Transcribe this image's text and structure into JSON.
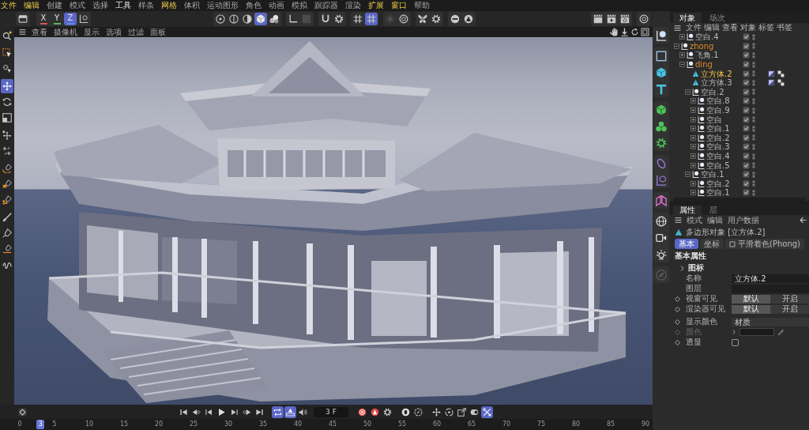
{
  "menu_bar": [
    {
      "label": "文件",
      "highlighted": true,
      "hovered": false
    },
    {
      "label": "编辑",
      "highlighted": true,
      "hovered": false
    },
    {
      "label": "创建",
      "highlighted": false,
      "hovered": false
    },
    {
      "label": "模式",
      "highlighted": false,
      "hovered": false
    },
    {
      "label": "选择",
      "highlighted": false,
      "hovered": false
    },
    {
      "label": "工具",
      "highlighted": false,
      "hovered": true
    },
    {
      "label": "样条",
      "highlighted": false,
      "hovered": false
    },
    {
      "label": "网格",
      "highlighted": true,
      "hovered": false
    },
    {
      "label": "体积",
      "highlighted": false,
      "hovered": false
    },
    {
      "label": "运动图形",
      "highlighted": false,
      "hovered": false
    },
    {
      "label": "角色",
      "highlighted": false,
      "hovered": false
    },
    {
      "label": "动画",
      "highlighted": false,
      "hovered": false
    },
    {
      "label": "模拟",
      "highlighted": false,
      "hovered": false
    },
    {
      "label": "跟踪器",
      "highlighted": false,
      "hovered": false
    },
    {
      "label": "渲染",
      "highlighted": false,
      "hovered": false
    },
    {
      "label": "扩展",
      "highlighted": true,
      "hovered": false
    },
    {
      "label": "窗口",
      "highlighted": true,
      "hovered": false
    },
    {
      "label": "帮助",
      "highlighted": false,
      "hovered": false
    }
  ],
  "toolbar": {
    "left": [
      [
        {
          "kind": "panel",
          "selected": false
        }
      ],
      [
        {
          "kind": "axis",
          "label": "X",
          "color": "#d9534f",
          "selected": false
        },
        {
          "kind": "axis",
          "label": "Y",
          "color": "#5cb85c",
          "selected": false
        },
        {
          "kind": "axis",
          "label": "Z",
          "color": "#5b8ee6",
          "selected": true
        },
        {
          "kind": "coord",
          "selected": false
        }
      ]
    ],
    "center": [
      [
        {
          "kind": "dotcircle",
          "selected": false
        },
        {
          "kind": "splitcircle",
          "selected": false
        },
        {
          "kind": "halfcircle",
          "selected": false
        },
        {
          "kind": "cube",
          "selected": true
        },
        {
          "kind": "cubes",
          "selected": false
        }
      ],
      [
        {
          "kind": "corner",
          "selected": false
        },
        {
          "kind": "blank",
          "selected": false
        }
      ],
      [
        {
          "kind": "magnet",
          "selected": false
        },
        {
          "kind": "gear",
          "selected": false
        }
      ],
      [
        {
          "kind": "hash",
          "selected": false
        },
        {
          "kind": "hash",
          "selected": true
        }
      ],
      [
        {
          "kind": "playcircle",
          "selected": false
        },
        {
          "kind": "ring",
          "selected": false
        }
      ],
      [
        {
          "kind": "butterfly",
          "selected": false
        },
        {
          "kind": "gear",
          "selected": false
        }
      ],
      [
        {
          "kind": "minuscircle",
          "selected": false
        },
        {
          "kind": "trianglecircle",
          "selected": false
        }
      ]
    ],
    "right": [
      [
        {
          "kind": "clapper",
          "selected": false
        },
        {
          "kind": "clapperplay",
          "selected": false
        },
        {
          "kind": "clappergear",
          "selected": false
        }
      ],
      [
        {
          "kind": "ring",
          "selected": false
        }
      ]
    ]
  },
  "tools": [
    [
      {
        "kind": "search",
        "selected": false
      }
    ],
    [
      {
        "kind": "selectrect",
        "selected": false
      },
      {
        "kind": "pointergear",
        "selected": false
      }
    ],
    [
      {
        "kind": "move",
        "selected": true
      },
      {
        "kind": "rotate",
        "selected": false
      },
      {
        "kind": "scale",
        "selected": false
      }
    ],
    [
      {
        "kind": "moveplus",
        "selected": false
      },
      {
        "kind": "scatter",
        "selected": false
      }
    ],
    [
      {
        "kind": "penarc",
        "selected": false
      },
      {
        "kind": "penrect",
        "selected": false
      },
      {
        "kind": "pendots",
        "selected": false
      }
    ],
    [
      {
        "kind": "brush",
        "selected": false
      },
      {
        "kind": "pen",
        "selected": false
      },
      {
        "kind": "penline",
        "selected": false
      },
      {
        "kind": "squiggle",
        "selected": false
      }
    ]
  ],
  "viewport": {
    "menu": [
      "查看",
      "摄像机",
      "显示",
      "选项",
      "过滤",
      "面板"
    ]
  },
  "timeline": {
    "key": [
      {
        "kind": "keydiamond",
        "selected": false
      }
    ],
    "transport": [
      {
        "kind": "first",
        "selected": false
      },
      {
        "kind": "prevkey",
        "selected": false
      },
      {
        "kind": "prevframe",
        "selected": false
      },
      {
        "kind": "play",
        "selected": false
      },
      {
        "kind": "nextframe",
        "selected": false
      },
      {
        "kind": "nextkey",
        "selected": false
      },
      {
        "kind": "last",
        "selected": false
      }
    ],
    "toggles": [
      {
        "kind": "loop",
        "selected": true
      },
      {
        "kind": "bars",
        "selected": true
      },
      {
        "kind": "speaker",
        "selected": false
      }
    ],
    "frame": "3 F",
    "record": [
      {
        "kind": "record",
        "selected": false
      },
      {
        "kind": "autokey",
        "selected": false
      },
      {
        "kind": "gear",
        "selected": false
      }
    ],
    "keys": [
      {
        "kind": "keylock",
        "selected": false
      },
      {
        "kind": "circledash",
        "selected": false
      }
    ],
    "tracks": [
      {
        "kind": "movecross",
        "selected": false
      },
      {
        "kind": "rotatekey",
        "selected": false
      },
      {
        "kind": "scalekey",
        "selected": false
      },
      {
        "kind": "pill",
        "selected": false
      },
      {
        "kind": "diagcross",
        "selected": true
      }
    ],
    "ruler": {
      "labels": [
        "0",
        "5",
        "10",
        "15",
        "20",
        "25",
        "30",
        "35",
        "40",
        "45",
        "50",
        "55",
        "60",
        "65",
        "70",
        "75",
        "80",
        "85",
        "90"
      ],
      "playhead": {
        "label": "3",
        "level": 0.0333
      }
    }
  },
  "palette": [
    [
      {
        "kind": "nullobj",
        "disabled": false
      }
    ],
    [
      {
        "kind": "rect",
        "disabled": false
      },
      {
        "kind": "cube3d",
        "disabled": false
      },
      {
        "kind": "text",
        "disabled": false
      }
    ],
    [
      {
        "kind": "greencube",
        "disabled": false
      },
      {
        "kind": "cloner",
        "disabled": false
      },
      {
        "kind": "greengear",
        "disabled": false
      }
    ],
    [
      {
        "kind": "capsule",
        "disabled": false
      },
      {
        "kind": "axisbox",
        "disabled": false
      }
    ],
    [
      {
        "kind": "fold",
        "disabled": false
      }
    ],
    [
      {
        "kind": "globe",
        "disabled": false
      },
      {
        "kind": "camera",
        "disabled": false
      },
      {
        "kind": "light",
        "disabled": false
      }
    ],
    [
      {
        "kind": "pencircle",
        "disabled": true
      }
    ]
  ],
  "object_manager": {
    "tabs": [
      {
        "label": "对象",
        "selected": true
      },
      {
        "label": "场次",
        "selected": false
      }
    ],
    "menu": [
      "文件",
      "编辑",
      "查看",
      "对象",
      "标签",
      "书签"
    ],
    "clipped_row": {
      "label": "空白.4",
      "kind": "null",
      "expanded": false,
      "selected": false,
      "highlighted": false,
      "enabled": true
    },
    "tree": [
      {
        "label": "zhong",
        "kind": "null",
        "expanded": true,
        "selected": false,
        "highlighted": true,
        "enabled": true,
        "children": [
          {
            "label": "飞角.1",
            "kind": "null",
            "expanded": false,
            "selected": false,
            "highlighted": false,
            "enabled": true
          },
          {
            "label": "ding",
            "kind": "null",
            "expanded": true,
            "selected": false,
            "highlighted": true,
            "enabled": true,
            "children": [
              {
                "label": "立方体.2",
                "kind": "polygon",
                "selected": true,
                "highlighted": false,
                "enabled": true,
                "tags": [
                  {
                    "kind": "phong"
                  },
                  {
                    "kind": "material"
                  }
                ]
              },
              {
                "label": "立方体.3",
                "kind": "polygon",
                "selected": false,
                "highlighted": false,
                "enabled": true,
                "tags": [
                  {
                    "kind": "phong"
                  },
                  {
                    "kind": "material"
                  }
                ]
              },
              {
                "label": "空白.2",
                "kind": "null",
                "expanded": true,
                "selected": false,
                "highlighted": false,
                "enabled": true,
                "children": [
                  {
                    "label": "空白.8",
                    "kind": "null",
                    "expanded": false,
                    "selected": false,
                    "highlighted": false,
                    "enabled": true
                  },
                  {
                    "label": "空白.9",
                    "kind": "null",
                    "expanded": false,
                    "selected": false,
                    "highlighted": false,
                    "enabled": true
                  },
                  {
                    "label": "空白",
                    "kind": "null",
                    "expanded": false,
                    "selected": false,
                    "highlighted": false,
                    "enabled": true
                  },
                  {
                    "label": "空白.1",
                    "kind": "null",
                    "expanded": false,
                    "selected": false,
                    "highlighted": false,
                    "enabled": true
                  },
                  {
                    "label": "空白.2",
                    "kind": "null",
                    "expanded": false,
                    "selected": false,
                    "highlighted": false,
                    "enabled": true
                  },
                  {
                    "label": "空白.3",
                    "kind": "null",
                    "expanded": false,
                    "selected": false,
                    "highlighted": false,
                    "enabled": true
                  },
                  {
                    "label": "空白.4",
                    "kind": "null",
                    "expanded": false,
                    "selected": false,
                    "highlighted": false,
                    "enabled": true
                  },
                  {
                    "label": "空白.5",
                    "kind": "null",
                    "expanded": false,
                    "selected": false,
                    "highlighted": false,
                    "enabled": true
                  }
                ]
              },
              {
                "label": "空白.1",
                "kind": "null",
                "expanded": true,
                "selected": false,
                "highlighted": false,
                "enabled": true,
                "children": [
                  {
                    "label": "空白.2",
                    "kind": "null",
                    "expanded": false,
                    "selected": false,
                    "highlighted": false,
                    "enabled": true
                  },
                  {
                    "label": "空白.1",
                    "kind": "null",
                    "expanded": false,
                    "selected": false,
                    "highlighted": false,
                    "enabled": true
                  }
                ]
              }
            ]
          }
        ]
      }
    ]
  },
  "attributes": {
    "tabs": [
      {
        "label": "属性",
        "selected": true
      },
      {
        "label": "层",
        "selected": false
      }
    ],
    "menu": [
      "模式",
      "编辑",
      "用户数据"
    ],
    "object_title": "多边形对象 [立方体.2]",
    "section_tabs": [
      {
        "label": "基本",
        "kind": "page",
        "selected": true
      },
      {
        "label": "坐标",
        "kind": "page",
        "selected": false
      },
      {
        "label": "平滑着色(Phong)",
        "kind": "tag",
        "selected": false
      }
    ],
    "section_title": "基本属性",
    "group": {
      "label": "图标",
      "expanded": false
    },
    "fields": [
      {
        "kind": "text",
        "label": "名称",
        "value": "立方体.2",
        "animatable": false,
        "disabled": false
      },
      {
        "kind": "text",
        "label": "图层",
        "animatable": false,
        "disabled": false
      },
      {
        "kind": "segmented",
        "label": "视窗可见",
        "animatable": true,
        "disabled": false,
        "options": [
          {
            "label": "默认",
            "selected": true
          },
          {
            "label": "开启",
            "selected": false
          }
        ]
      },
      {
        "kind": "segmented",
        "label": "渲染器可见",
        "animatable": true,
        "disabled": false,
        "options": [
          {
            "label": "默认",
            "selected": true
          },
          {
            "label": "开启",
            "selected": false
          }
        ]
      },
      {
        "kind": "dropdown",
        "label": "显示颜色",
        "value": "材质",
        "animatable": true,
        "disabled": false
      },
      {
        "kind": "color",
        "label": "颜色",
        "animatable": true,
        "disabled": true
      },
      {
        "kind": "checkbox",
        "label": "透显",
        "checked": false,
        "animatable": true,
        "disabled": false
      }
    ]
  }
}
